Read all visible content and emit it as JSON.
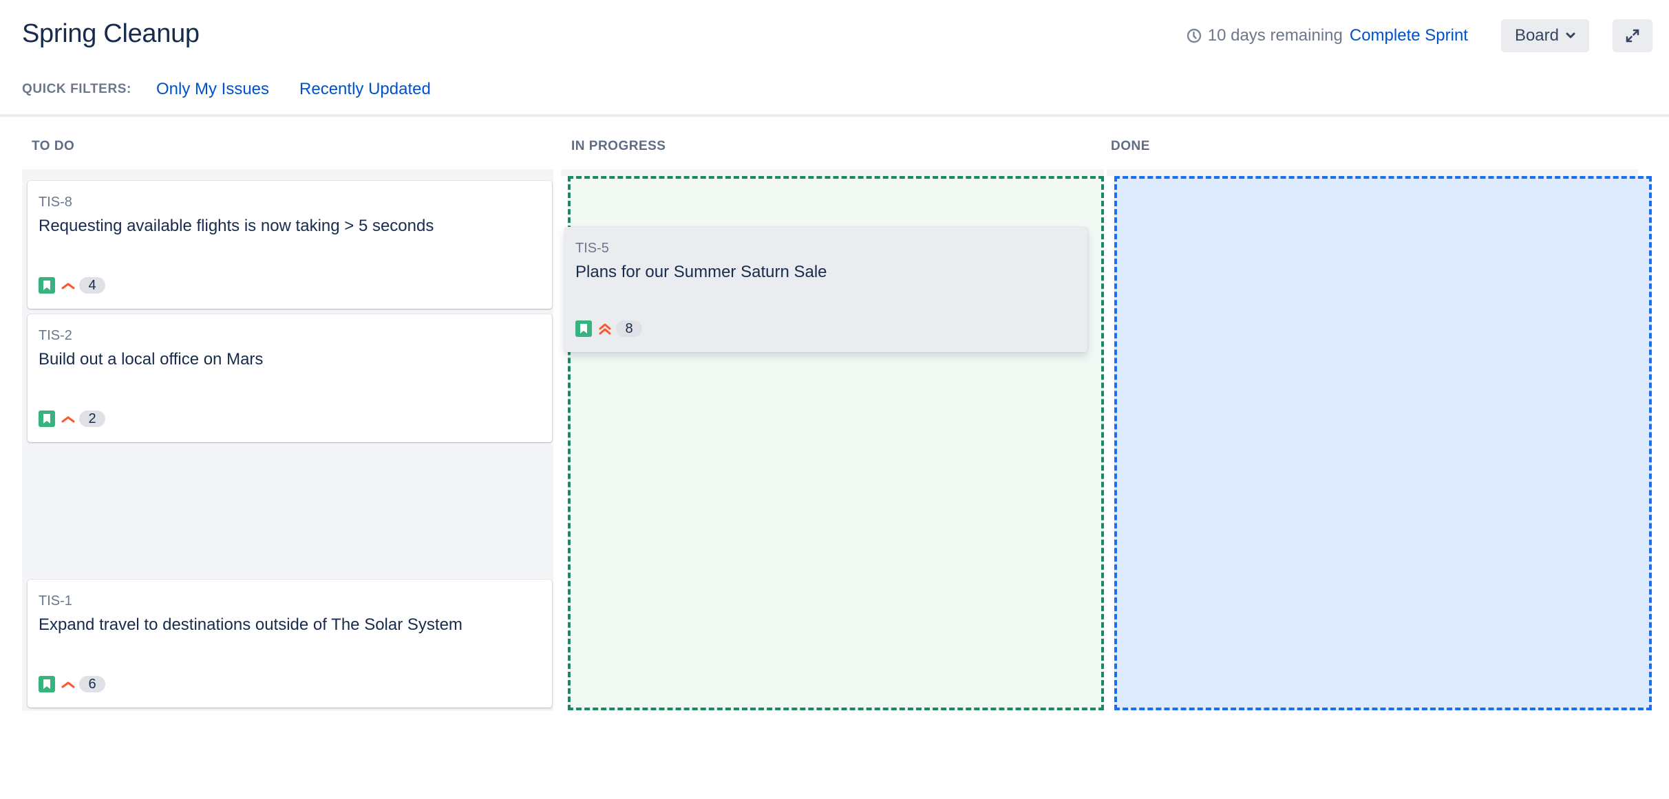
{
  "header": {
    "title": "Spring Cleanup",
    "remaining_text": "10 days remaining",
    "clock_icon": "clock-icon",
    "complete_sprint_label": "Complete Sprint",
    "board_button_label": "Board",
    "board_chevron_icon": "chevron-down-icon",
    "fullscreen_icon": "expand-icon"
  },
  "quick_filters": {
    "label": "QUICK FILTERS:",
    "items": [
      {
        "label": "Only My Issues"
      },
      {
        "label": "Recently Updated"
      }
    ]
  },
  "columns": [
    {
      "title": "TO DO",
      "cards": [
        {
          "key": "TIS-8",
          "summary": "Requesting available flights is now taking > 5 seconds",
          "type_icon": "story-icon",
          "priority_icon": "priority-medium-icon",
          "points": "4"
        },
        {
          "key": "TIS-2",
          "summary": "Build out a local office on Mars",
          "type_icon": "story-icon",
          "priority_icon": "priority-medium-icon",
          "points": "2"
        },
        {
          "key": "TIS-1",
          "summary": "Expand travel to destinations outside of The Solar System",
          "type_icon": "story-icon",
          "priority_icon": "priority-medium-icon",
          "points": "6"
        }
      ]
    },
    {
      "title": "IN PROGRESS",
      "dropzone_color": "#1a8a5e",
      "cards": [
        {
          "key": "TIS-5",
          "summary": "Plans for our Summer Saturn Sale",
          "type_icon": "story-icon",
          "priority_icon": "priority-high-icon",
          "points": "8",
          "state": "dragging"
        }
      ]
    },
    {
      "title": "DONE",
      "dropzone_color": "#1a6ff0",
      "cards": []
    }
  ],
  "colors": {
    "link": "#0052cc",
    "story": "#36b37e",
    "priority": "#ff5630",
    "text_primary": "#172b4d",
    "text_subtle": "#6b778c"
  }
}
